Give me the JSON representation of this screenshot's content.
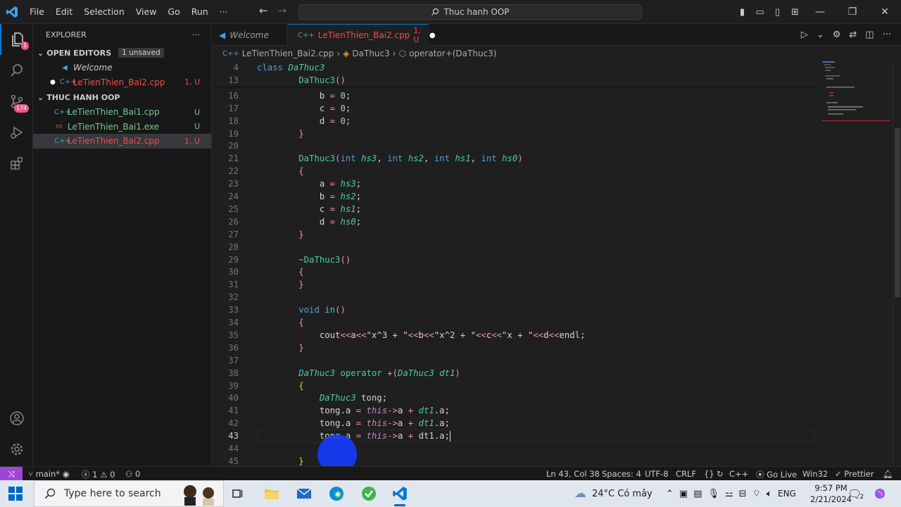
{
  "titlebar": {
    "menu": [
      "File",
      "Edit",
      "Selection",
      "View",
      "Go",
      "Run",
      "···"
    ],
    "search_text": "Thuc hanh OOP"
  },
  "activity": {
    "scm_badge": "174",
    "explorer_badge": "1"
  },
  "explorer": {
    "title": "EXPLORER",
    "open_editors_label": "OPEN EDITORS",
    "unsaved_badge": "1 unsaved",
    "open_editors": [
      {
        "name": "Welcome",
        "status": ""
      },
      {
        "name": "LeTienThien_Bai2.cpp",
        "status": "1, U"
      }
    ],
    "folder_label": "THUC HANH OOP",
    "files": [
      {
        "name": "LeTienThien_Bai1.cpp",
        "status": "U",
        "color": "#73c991"
      },
      {
        "name": "LeTienThien_Bai1.exe",
        "status": "U",
        "color": "#73c991"
      },
      {
        "name": "LeTienThien_Bai2.cpp",
        "status": "1, U",
        "color": "#f14c4c"
      }
    ]
  },
  "tabs": {
    "tab1": "Welcome",
    "tab2": "LeTienThien_Bai2.cpp",
    "tab2_status": "1, U"
  },
  "breadcrumb": {
    "file": "LeTienThien_Bai2.cpp",
    "class": "DaThuc3",
    "member": "operator+(DaThuc3)"
  },
  "code": {
    "sticky": [
      {
        "ln": "4",
        "html": "<span class='k'>class</span> <span class='ty'>DaThuc3</span>"
      },
      {
        "ln": "13",
        "html": "        <span class='fn'>DaThuc3</span><span class='br2'>()</span>"
      }
    ],
    "lines": [
      {
        "ln": "16",
        "html": "            <span class='wh'>b</span> <span class='op'>=</span> <span class='num'>0</span>;"
      },
      {
        "ln": "17",
        "html": "            <span class='wh'>c</span> <span class='op'>=</span> <span class='num'>0</span>;"
      },
      {
        "ln": "18",
        "html": "            <span class='wh'>d</span> <span class='op'>=</span> <span class='num'>0</span>;"
      },
      {
        "ln": "19",
        "html": "        <span class='br2'>}</span>"
      },
      {
        "ln": "20",
        "html": ""
      },
      {
        "ln": "21",
        "html": "        <span class='fn'>DaThuc3</span><span class='br2'>(</span><span class='k'>int</span> <span class='it'>hs3</span>, <span class='k'>int</span> <span class='it'>hs2</span>, <span class='k'>int</span> <span class='it'>hs1</span>, <span class='k'>int</span> <span class='it'>hs0</span><span class='br2'>)</span>"
      },
      {
        "ln": "22",
        "html": "        <span class='br2'>{</span>"
      },
      {
        "ln": "23",
        "html": "            <span class='wh'>a</span> <span class='op'>=</span> <span class='it'>hs3</span>;"
      },
      {
        "ln": "24",
        "html": "            <span class='wh'>b</span> <span class='op'>=</span> <span class='it'>hs2</span>;"
      },
      {
        "ln": "25",
        "html": "            <span class='wh'>c</span> <span class='op'>=</span> <span class='it'>hs1</span>;"
      },
      {
        "ln": "26",
        "html": "            <span class='wh'>d</span> <span class='op'>=</span> <span class='it'>hs0</span>;"
      },
      {
        "ln": "27",
        "html": "        <span class='br2'>}</span>"
      },
      {
        "ln": "28",
        "html": ""
      },
      {
        "ln": "29",
        "html": "        <span class='fn'>~DaThuc3</span><span class='br2'>()</span>"
      },
      {
        "ln": "30",
        "html": "        <span class='br2'>{</span>"
      },
      {
        "ln": "31",
        "html": "        <span class='br2'>}</span>"
      },
      {
        "ln": "32",
        "html": ""
      },
      {
        "ln": "33",
        "html": "        <span class='k'>void</span> <span class='fn'>in</span><span class='br2'>()</span>"
      },
      {
        "ln": "34",
        "html": "        <span class='br2'>{</span>"
      },
      {
        "ln": "35",
        "html": "            <span class='wh'>cout</span><span class='op'>&lt;&lt;</span>a<span class='op'>&lt;&lt;</span><span class='wh'>\"x^3 + \"</span><span class='op'>&lt;&lt;</span>b<span class='op'>&lt;&lt;</span><span class='wh'>\"x^2 + \"</span><span class='op'>&lt;&lt;</span>c<span class='op'>&lt;&lt;</span><span class='wh'>\"x + \"</span><span class='op'>&lt;&lt;</span>d<span class='op'>&lt;&lt;</span>endl;"
      },
      {
        "ln": "36",
        "html": "        <span class='br2'>}</span>"
      },
      {
        "ln": "37",
        "html": ""
      },
      {
        "ln": "38",
        "html": "        <span class='ty'>DaThuc3</span> <span class='fn'>operator</span> <span class='op'>+</span><span class='br2'>(</span><span class='ty'>DaThuc3</span> <span class='it'>dt1</span><span class='br2'>)</span>"
      },
      {
        "ln": "39",
        "html": "        <span class='br1'>{</span>"
      },
      {
        "ln": "40",
        "html": "            <span class='ty'>DaThuc3</span> <span class='wh'>tong</span>;"
      },
      {
        "ln": "41",
        "html": "            <span class='wh'>tong</span>.<span class='wh'>a</span> <span class='op'>=</span> <span class='th'>this</span><span class='op'>-&gt;</span>a <span class='op'>+</span> <span class='it'>dt1</span>.a;"
      },
      {
        "ln": "42",
        "html": "            <span class='wh'>tong</span>.<span class='wh'>a</span> <span class='op'>=</span> <span class='th'>this</span><span class='op'>-&gt;</span>a <span class='op'>+</span> <span class='it'>dt1</span>.a;"
      },
      {
        "ln": "43",
        "html": "            <span class='wh'>tong</span>.<span class='wh'>a</span> <span class='op'>=</span> <span class='th'>this</span><span class='op'>-&gt;</span>a <span class='op'>+</span> <span class='wh'>dt1</span>.a;"
      },
      {
        "ln": "44",
        "html": ""
      },
      {
        "ln": "45",
        "html": "        <span class='br1'>}</span>"
      }
    ],
    "current_line": "43"
  },
  "statusbar": {
    "branch": "main*",
    "errors": "1",
    "warnings": "0",
    "ports": "0",
    "position": "Ln 43, Col 38",
    "spaces": "Spaces: 4",
    "encoding": "UTF-8",
    "eol": "CRLF",
    "language": "C++",
    "golive": "Go Live",
    "platform": "Win32",
    "prettier": "Prettier"
  },
  "taskbar": {
    "search_placeholder": "Type here to search",
    "weather": "24°C  Có mây",
    "lang": "ENG",
    "time": "9:57 PM",
    "date": "2/21/2024",
    "notif_count": "2"
  },
  "colors": {
    "accent": "#0078d4",
    "error_red": "#f14c4c",
    "untracked_green": "#73c991",
    "remote_purple": "#a046d6"
  }
}
